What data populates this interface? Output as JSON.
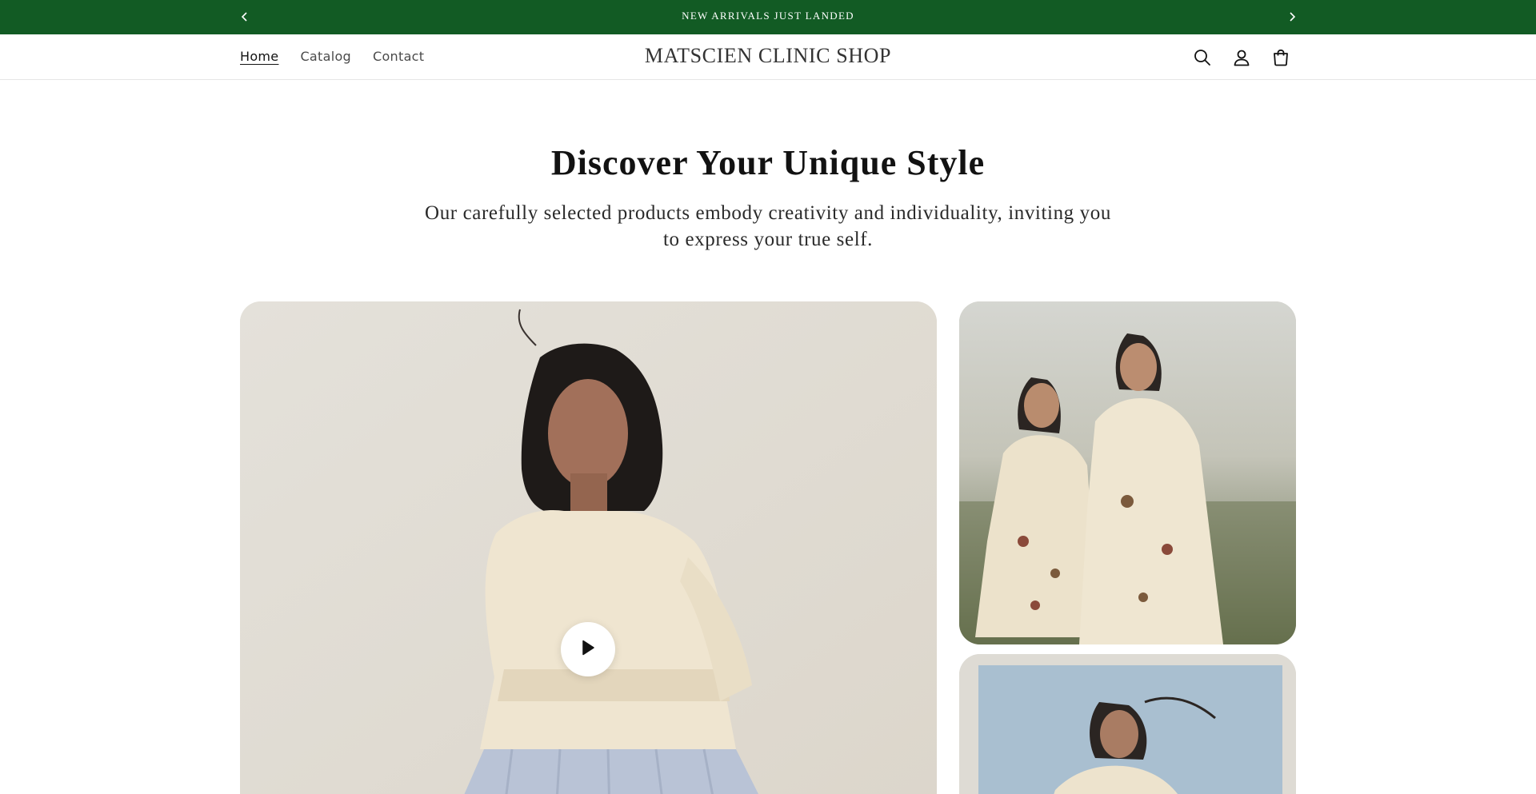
{
  "announcement": {
    "text": "NEW ARRIVALS JUST LANDED",
    "prev_icon": "chevron-left-icon",
    "next_icon": "chevron-right-icon",
    "background": "#125b24"
  },
  "header": {
    "brand": "MATSCIEN CLINIC SHOP",
    "nav": [
      {
        "label": "Home",
        "active": true
      },
      {
        "label": "Catalog",
        "active": false
      },
      {
        "label": "Contact",
        "active": false
      }
    ],
    "icons": [
      "search-icon",
      "account-icon",
      "cart-icon"
    ]
  },
  "hero": {
    "title": "Discover Your Unique Style",
    "subtitle": "Our carefully selected products embody creativity and individuality, inviting you to express your true self."
  },
  "media": {
    "main": {
      "kind": "video",
      "play_icon": "play-icon"
    },
    "side": [
      {
        "kind": "image"
      },
      {
        "kind": "image"
      }
    ]
  }
}
